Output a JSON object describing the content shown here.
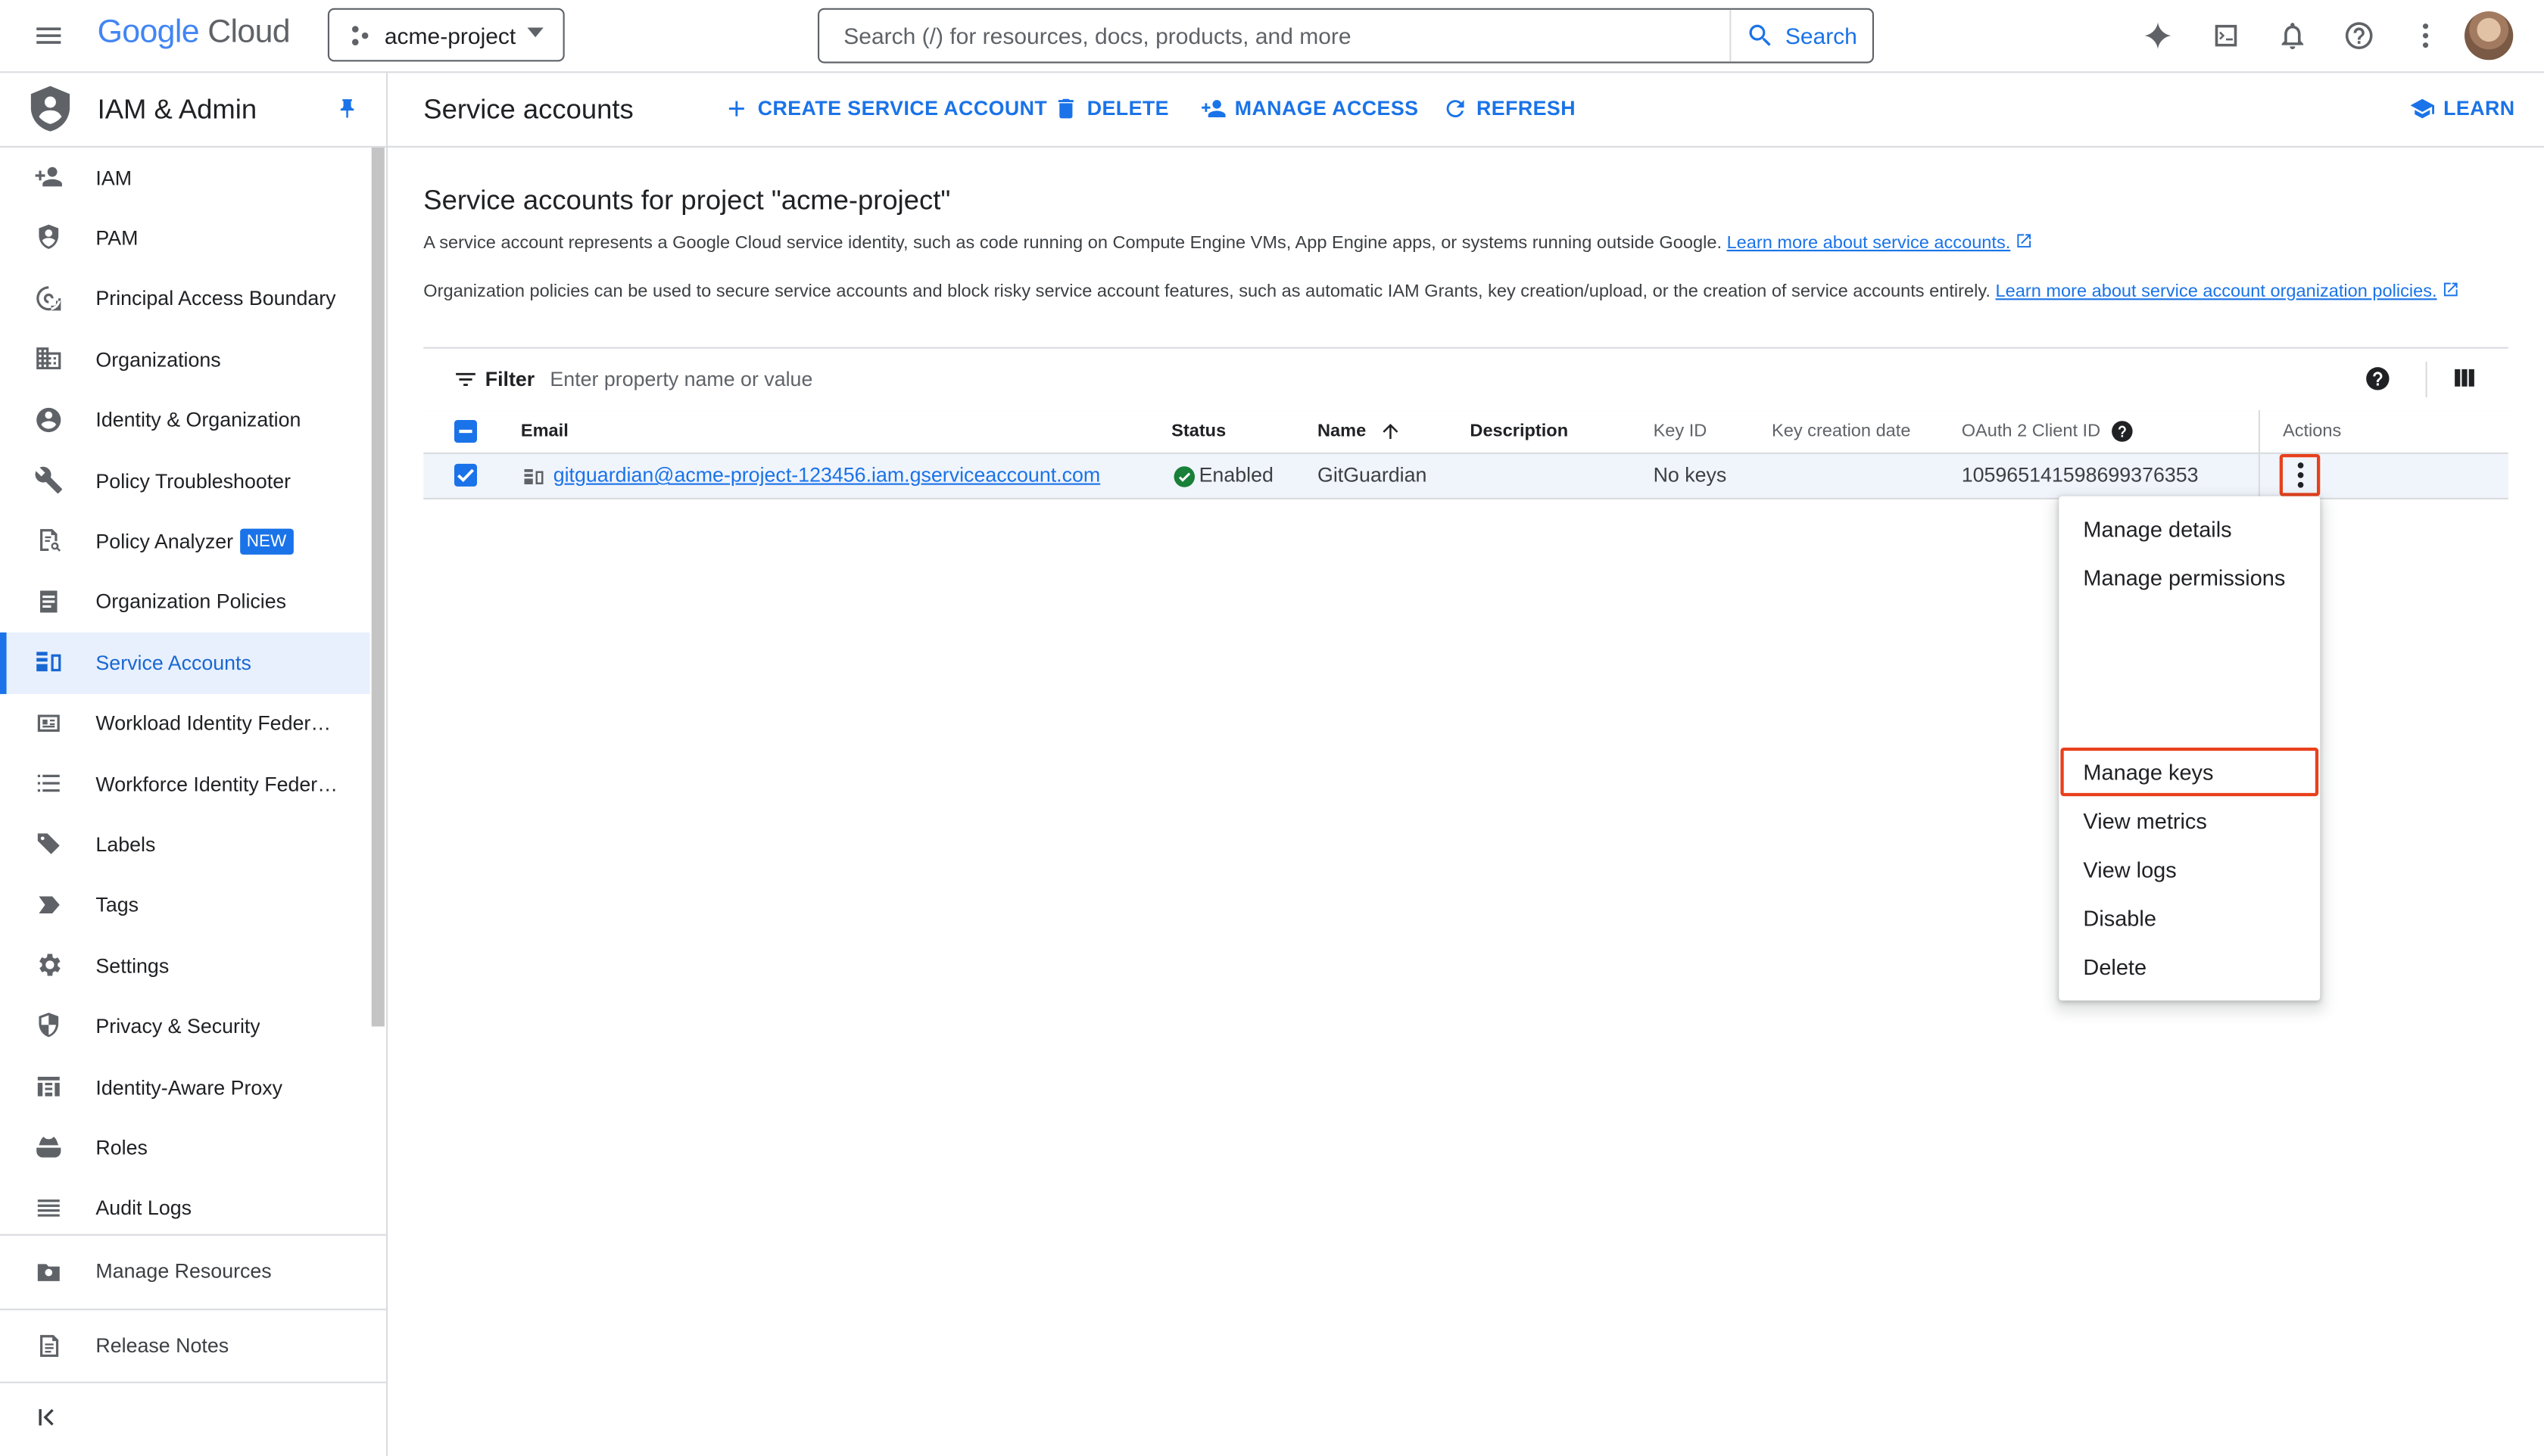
{
  "header": {
    "logo_google": "Google",
    "logo_cloud": "Cloud",
    "project": "acme-project",
    "search_placeholder": "Search (/) for resources, docs, products, and more",
    "search_button": "Search"
  },
  "sidebar": {
    "title": "IAM & Admin",
    "items": [
      {
        "label": "IAM",
        "icon": "person-add-icon"
      },
      {
        "label": "PAM",
        "icon": "shield-icon"
      },
      {
        "label": "Principal Access Boundary",
        "icon": "boundary-icon"
      },
      {
        "label": "Organizations",
        "icon": "organizations-icon"
      },
      {
        "label": "Identity & Organization",
        "icon": "account-circle-icon"
      },
      {
        "label": "Policy Troubleshooter",
        "icon": "wrench-icon"
      },
      {
        "label": "Policy Analyzer",
        "icon": "analyzer-icon",
        "badge": "NEW"
      },
      {
        "label": "Organization Policies",
        "icon": "list-doc-icon"
      },
      {
        "label": "Service Accounts",
        "icon": "service-account-icon",
        "active": true
      },
      {
        "label": "Workload Identity Federat…",
        "icon": "badge-icon"
      },
      {
        "label": "Workforce Identity Federa…",
        "icon": "list-icon"
      },
      {
        "label": "Labels",
        "icon": "label-icon"
      },
      {
        "label": "Tags",
        "icon": "tag-icon"
      },
      {
        "label": "Settings",
        "icon": "gear-icon"
      },
      {
        "label": "Privacy & Security",
        "icon": "privacy-shield-icon"
      },
      {
        "label": "Identity-Aware Proxy",
        "icon": "proxy-icon"
      },
      {
        "label": "Roles",
        "icon": "roles-icon"
      },
      {
        "label": "Audit Logs",
        "icon": "audit-icon"
      }
    ],
    "footer": [
      {
        "label": "Manage Resources",
        "icon": "manage-resources-icon"
      },
      {
        "label": "Release Notes",
        "icon": "release-notes-icon"
      }
    ],
    "collapse_label": "<|"
  },
  "toolbar": {
    "page_title": "Service accounts",
    "create": "CREATE SERVICE ACCOUNT",
    "delete": "DELETE",
    "manage_access": "MANAGE ACCESS",
    "refresh": "REFRESH",
    "learn": "LEARN"
  },
  "main": {
    "heading": "Service accounts for project \"acme-project\"",
    "desc1": "A service account represents a Google Cloud service identity, such as code running on Compute Engine VMs, App Engine apps, or systems running outside Google.",
    "desc1_link": "Learn more about service accounts.",
    "desc2": "Organization policies can be used to secure service accounts and block risky service account features, such as automatic IAM Grants, key creation/upload, or the creation of service accounts entirely.",
    "desc2_link": "Learn more about service account organization policies.",
    "filter_label": "Filter",
    "filter_placeholder": "Enter property name or value"
  },
  "table": {
    "columns": [
      "Email",
      "Status",
      "Name",
      "Description",
      "Key ID",
      "Key creation date",
      "OAuth 2 Client ID",
      "Actions"
    ],
    "rows": [
      {
        "email": "gitguardian@acme-project-123456.iam.gserviceaccount.com",
        "status": "Enabled",
        "name": "GitGuardian",
        "description": "",
        "key_id": "No keys",
        "key_creation_date": "",
        "oauth_client_id": "105965141598699376353"
      }
    ]
  },
  "menu": {
    "items": [
      "Manage details",
      "Manage permissions",
      "Manage keys",
      "View metrics",
      "View logs",
      "Disable",
      "Delete"
    ],
    "highlighted": "Manage keys"
  },
  "colors": {
    "accent": "#1a73e8",
    "highlight_outline": "#e8401c",
    "status_enabled": "#188038"
  }
}
